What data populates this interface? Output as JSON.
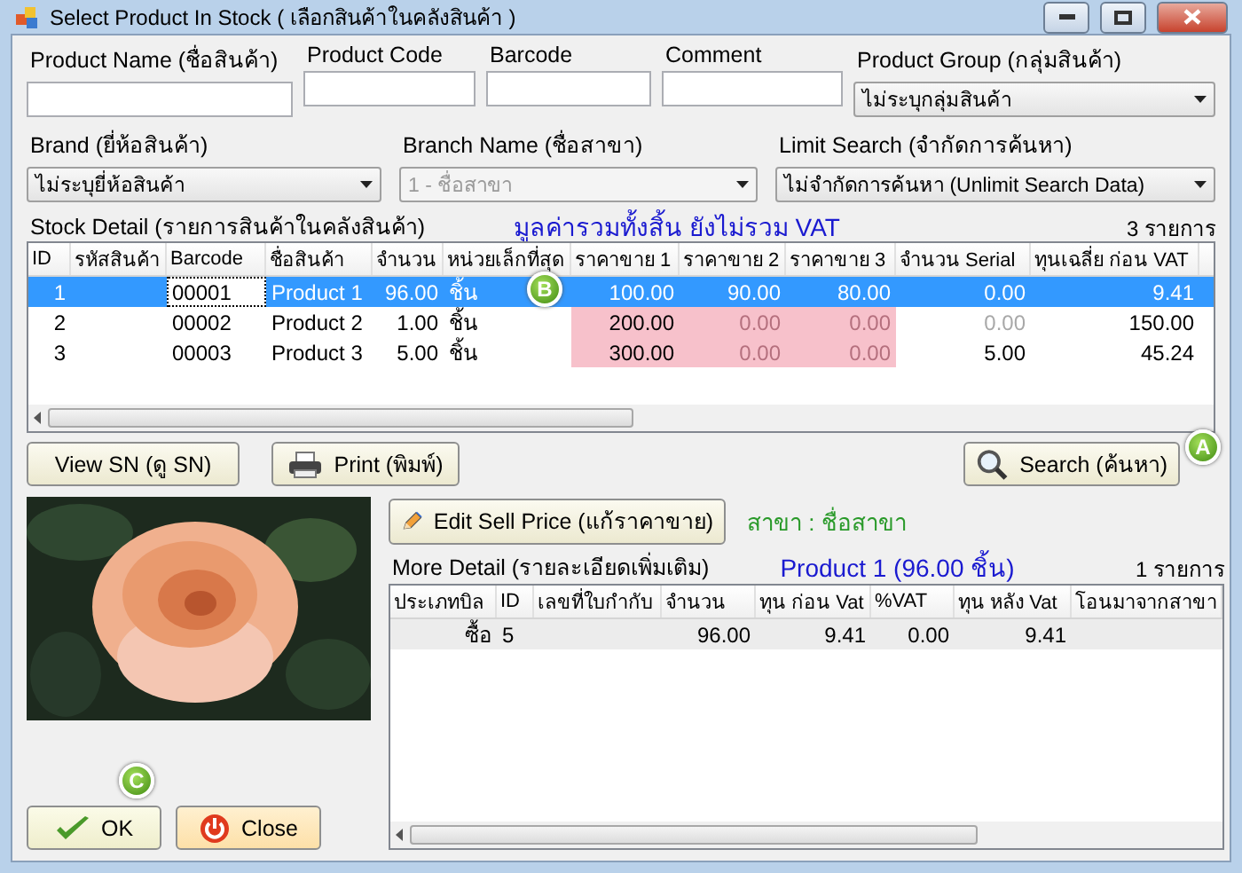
{
  "window": {
    "title": "Select Product In Stock ( เลือกสินค้าในคลังสินค้า )"
  },
  "filters_top": [
    {
      "label": "Product Name (ชื่อสินค้า)",
      "kind": "text"
    },
    {
      "label": "Product Code",
      "kind": "text"
    },
    {
      "label": "Barcode",
      "kind": "text"
    },
    {
      "label": "Comment",
      "kind": "text"
    },
    {
      "label": "Product Group (กลุ่มสินค้า)",
      "kind": "combo",
      "value": "ไม่ระบุกลุ่มสินค้า",
      "disabled": false
    }
  ],
  "filters_bottom": [
    {
      "label": "Brand (ยี่ห้อสินค้า)",
      "kind": "combo",
      "value": "ไม่ระบุยี่ห้อสินค้า",
      "disabled": false
    },
    {
      "label": "Branch Name (ชื่อสาขา)",
      "kind": "combo",
      "value": "1 - ชื่อสาขา",
      "disabled": true
    },
    {
      "label": "Limit Search (จำกัดการค้นหา)",
      "kind": "combo",
      "value": "ไม่จำกัดการค้นหา (Unlimit Search Data)",
      "disabled": false
    }
  ],
  "stock": {
    "label": "Stock Detail (รายการสินค้าในคลังสินค้า)",
    "note": "มูลค่ารวมทั้งสิ้น ยังไม่รวม VAT",
    "count": "3 รายการ",
    "columns": [
      "ID",
      "รหัสสินค้า",
      "Barcode",
      "ชื่อสินค้า",
      "จำนวน",
      "หน่วยเล็กที่สุด",
      "ราคาขาย 1",
      "ราคาขาย 2",
      "ราคาขาย 3",
      "จำนวน Serial",
      "ทุนเฉลี่ย ก่อน VAT"
    ],
    "rows": [
      {
        "selected": true,
        "cells": [
          {
            "text": "1"
          },
          {},
          {
            "text": "00001",
            "kind": "focus"
          },
          {
            "text": "Product 1"
          },
          {
            "text": "96.00"
          },
          {
            "text": "ชิ้น"
          },
          {
            "text": "100.00"
          },
          {
            "text": "90.00"
          },
          {
            "text": "80.00"
          },
          {
            "text": "0.00"
          },
          {
            "text": "9.41"
          }
        ]
      },
      {
        "selected": false,
        "cells": [
          {
            "text": "2"
          },
          {},
          {
            "text": "00002"
          },
          {
            "text": "Product 2"
          },
          {
            "text": "1.00"
          },
          {
            "text": "ชิ้น"
          },
          {
            "text": "200.00",
            "kind": "pink"
          },
          {
            "text": "0.00",
            "kind": "pink-dim"
          },
          {
            "text": "0.00",
            "kind": "pink-dim"
          },
          {
            "text": "0.00",
            "kind": "dim"
          },
          {
            "text": "150.00"
          }
        ]
      },
      {
        "selected": false,
        "cells": [
          {
            "text": "3"
          },
          {},
          {
            "text": "00003"
          },
          {
            "text": "Product 3"
          },
          {
            "text": "5.00"
          },
          {
            "text": "ชิ้น"
          },
          {
            "text": "300.00",
            "kind": "pink"
          },
          {
            "text": "0.00",
            "kind": "pink-dim"
          },
          {
            "text": "0.00",
            "kind": "pink-dim"
          },
          {
            "text": "5.00"
          },
          {
            "text": "45.24"
          }
        ]
      }
    ]
  },
  "buttons": {
    "view_sn": "View SN (ดู SN)",
    "print": "Print (พิมพ์)",
    "search": "Search (ค้นหา)",
    "edit_price": "Edit Sell Price (แก้ราคาขาย)",
    "ok": "OK",
    "close": "Close"
  },
  "branch": "สาขา : ชื่อสาขา",
  "more": {
    "label": "More Detail (รายละเอียดเพิ่มเติม)",
    "product": "Product 1 (96.00 ชิ้น)",
    "count": "1 รายการ",
    "columns": [
      "ประเภทบิล",
      "ID",
      "เลขที่ใบกำกับ",
      "จำนวน",
      "ทุน ก่อน Vat",
      "%VAT",
      "ทุน หลัง Vat",
      "โอนมาจากสาขา"
    ],
    "rows": [
      {
        "cells": [
          "ซื้อ",
          "5",
          "",
          "96.00",
          "9.41",
          "0.00",
          "9.41",
          ""
        ]
      }
    ]
  },
  "annotations": [
    "A",
    "B",
    "C"
  ]
}
